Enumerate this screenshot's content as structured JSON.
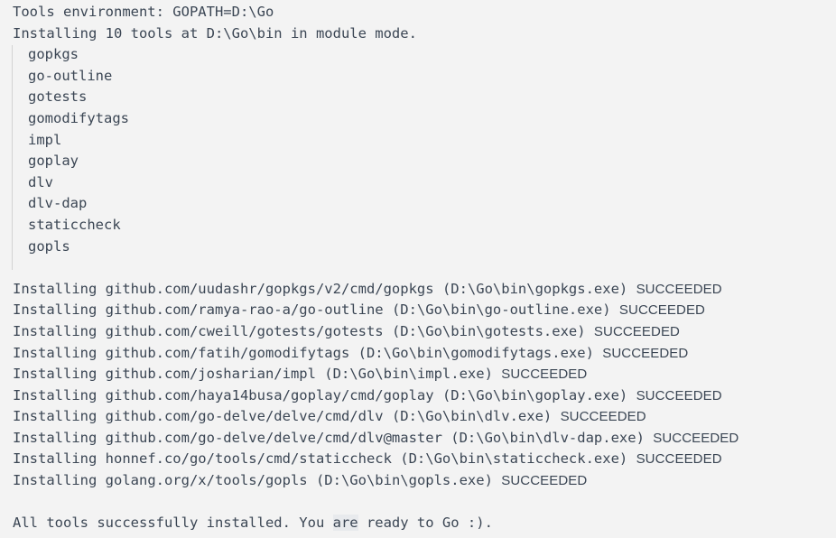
{
  "panel": {
    "background_color": "#f3f3f3",
    "text_color": "#3b4654",
    "guide_rule_color": "#d3d3d3",
    "highlight_color": "#e8eaed"
  },
  "header": {
    "environment_line": "Tools environment: GOPATH=D:\\Go",
    "installing_line": "Installing 10 tools at D:\\Go\\bin in module mode."
  },
  "tool_list": [
    {
      "name": "gopkgs"
    },
    {
      "name": "go-outline"
    },
    {
      "name": "gotests"
    },
    {
      "name": "gomodifytags"
    },
    {
      "name": "impl"
    },
    {
      "name": "goplay"
    },
    {
      "name": "dlv"
    },
    {
      "name": "dlv-dap"
    },
    {
      "name": "staticcheck"
    },
    {
      "name": "gopls"
    }
  ],
  "install_results": [
    {
      "prefix": "Installing ",
      "package": "github.com/uudashr/gopkgs/v2/cmd/gopkgs",
      "target": " (D:\\Go\\bin\\gopkgs.exe) ",
      "status": "SUCCEEDED"
    },
    {
      "prefix": "Installing ",
      "package": "github.com/ramya-rao-a/go-outline",
      "target": " (D:\\Go\\bin\\go-outline.exe) ",
      "status": "SUCCEEDED"
    },
    {
      "prefix": "Installing ",
      "package": "github.com/cweill/gotests/gotests",
      "target": " (D:\\Go\\bin\\gotests.exe) ",
      "status": "SUCCEEDED"
    },
    {
      "prefix": "Installing ",
      "package": "github.com/fatih/gomodifytags",
      "target": " (D:\\Go\\bin\\gomodifytags.exe) ",
      "status": "SUCCEEDED"
    },
    {
      "prefix": "Installing ",
      "package": "github.com/josharian/impl",
      "target": " (D:\\Go\\bin\\impl.exe) ",
      "status": "SUCCEEDED"
    },
    {
      "prefix": "Installing ",
      "package": "github.com/haya14busa/goplay/cmd/goplay",
      "target": " (D:\\Go\\bin\\goplay.exe) ",
      "status": "SUCCEEDED"
    },
    {
      "prefix": "Installing ",
      "package": "github.com/go-delve/delve/cmd/dlv",
      "target": " (D:\\Go\\bin\\dlv.exe) ",
      "status": "SUCCEEDED"
    },
    {
      "prefix": "Installing ",
      "package": "github.com/go-delve/delve/cmd/dlv@master",
      "target": " (D:\\Go\\bin\\dlv-dap.exe) ",
      "status": "SUCCEEDED"
    },
    {
      "prefix": "Installing ",
      "package": "honnef.co/go/tools/cmd/staticcheck",
      "target": " (D:\\Go\\bin\\staticcheck.exe) ",
      "status": "SUCCEEDED"
    },
    {
      "prefix": "Installing ",
      "package": "golang.org/x/tools/gopls",
      "target": " (D:\\Go\\bin\\gopls.exe) ",
      "status": "SUCCEEDED"
    }
  ],
  "footer": {
    "part1": "All tools successfully installed. You ",
    "highlighted": "are",
    "part2": " ready to Go :)."
  }
}
